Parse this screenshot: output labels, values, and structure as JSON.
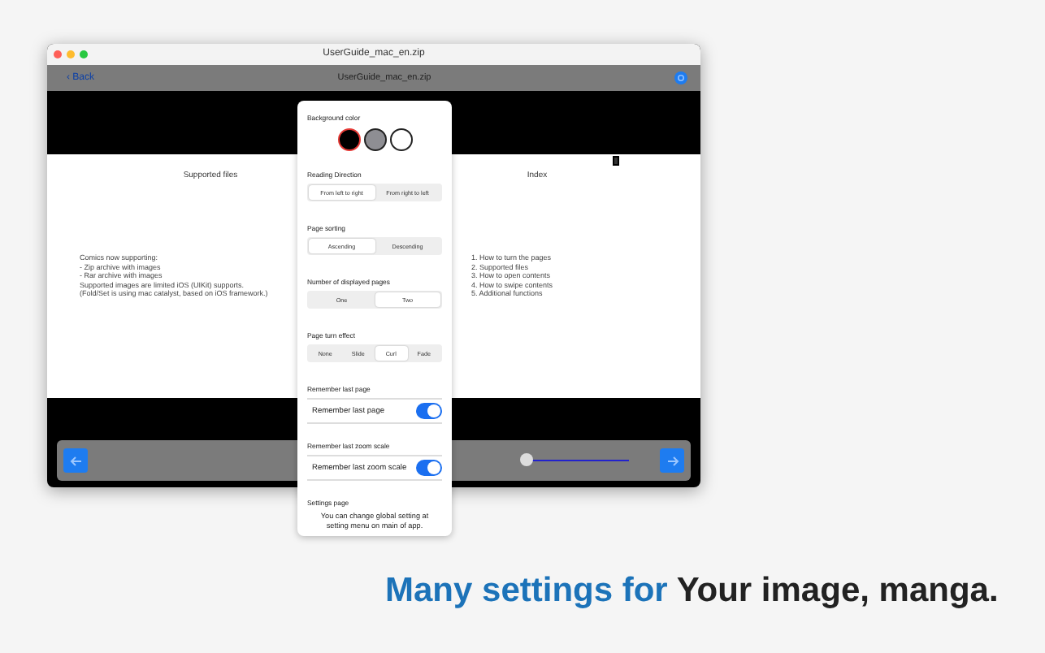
{
  "window": {
    "title": "UserGuide_mac_en.zip"
  },
  "toolbar": {
    "back": "‹ Back",
    "title": "UserGuide_mac_en.zip"
  },
  "pages": [
    {
      "title": "Supported files",
      "paragraphs": [
        "Comics now supporting:",
        "- Zip archive with images",
        "- Rar archive with images",
        "Supported images are limited iOS (UIKit) supports.",
        "(Fold/Set is using mac catalyst, based on iOS framework.)"
      ]
    },
    {
      "title": "Index",
      "paragraphs": [
        "1. How to turn the pages",
        "2. Supported files",
        "3. How to open contents",
        "4. How to swipe contents",
        "5. Additional functions"
      ]
    }
  ],
  "slider": {
    "level": 0
  },
  "settings": [
    {
      "kind": "swatches",
      "label": "Background color",
      "options": [
        {
          "color": "#000000",
          "selected": true
        },
        {
          "color": "#8e8e93",
          "selected": false
        },
        {
          "color": "#ffffff",
          "selected": false
        }
      ]
    },
    {
      "kind": "segments",
      "label": "Reading Direction",
      "options": [
        {
          "label": "From left to right",
          "selected": true
        },
        {
          "label": "From right to left",
          "selected": false
        }
      ]
    },
    {
      "kind": "segments",
      "label": "Page sorting",
      "options": [
        {
          "label": "Ascending",
          "selected": true
        },
        {
          "label": "Descending",
          "selected": false
        }
      ]
    },
    {
      "kind": "segments",
      "label": "Number of displayed pages",
      "options": [
        {
          "label": "One",
          "selected": false
        },
        {
          "label": "Two",
          "selected": true
        }
      ]
    },
    {
      "kind": "segments",
      "label": "Page turn effect",
      "options": [
        {
          "label": "None",
          "selected": false
        },
        {
          "label": "Slide",
          "selected": false
        },
        {
          "label": "Curl",
          "selected": true
        },
        {
          "label": "Fade",
          "selected": false
        }
      ]
    },
    {
      "kind": "toggle",
      "label": "Remember last page",
      "text": "Remember last page",
      "on": true
    },
    {
      "kind": "toggle",
      "label": "Remember last zoom scale",
      "text": "Remember last zoom scale",
      "on": true
    },
    {
      "kind": "note",
      "label": "Settings page",
      "text": "You can change global setting at setting menu on main of app."
    }
  ],
  "caption": {
    "highlight": "Many settings for",
    "rest": "Your image, manga."
  }
}
